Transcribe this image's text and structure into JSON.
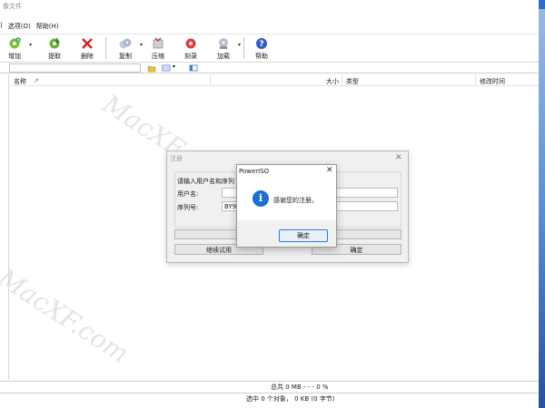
{
  "window": {
    "title_fragment": "像文件"
  },
  "menu": {
    "items": [
      ")",
      "选项(O)",
      "帮助(H)"
    ]
  },
  "toolbar": {
    "buttons": [
      {
        "label": "增加",
        "icon": "add-icon"
      },
      {
        "label": "提取",
        "icon": "extract-icon"
      },
      {
        "label": "删除",
        "icon": "delete-icon"
      },
      {
        "label": "复制",
        "icon": "copy-disc-icon"
      },
      {
        "label": "压缩",
        "icon": "compress-icon"
      },
      {
        "label": "刻录",
        "icon": "burn-icon"
      },
      {
        "label": "加载",
        "icon": "mount-icon"
      },
      {
        "label": "帮助",
        "icon": "help-icon"
      }
    ]
  },
  "address": {
    "value": ""
  },
  "list_header": {
    "name": "名称",
    "size": "大小",
    "type": "类型",
    "modified": "修改时间"
  },
  "status": {
    "total": "总共  0 MB    - - - 0 %",
    "selected": "选中 0 个对象，  0 KB (0 字节)"
  },
  "watermark": {
    "text": "MacXF.com"
  },
  "register_dialog": {
    "title": "注册",
    "prompt": "请输入用户名和序列",
    "user_label": "用户名:",
    "serial_label": "序列号:",
    "serial_value": "BY93U",
    "continue_button": "继续试用",
    "ok_button": "确定"
  },
  "message_box": {
    "title": "PowerISO",
    "text": "感谢您的注册。",
    "ok_button": "确定"
  },
  "colors": {
    "accent": "#1e6fd0",
    "ok_border": "#2f78d6"
  }
}
